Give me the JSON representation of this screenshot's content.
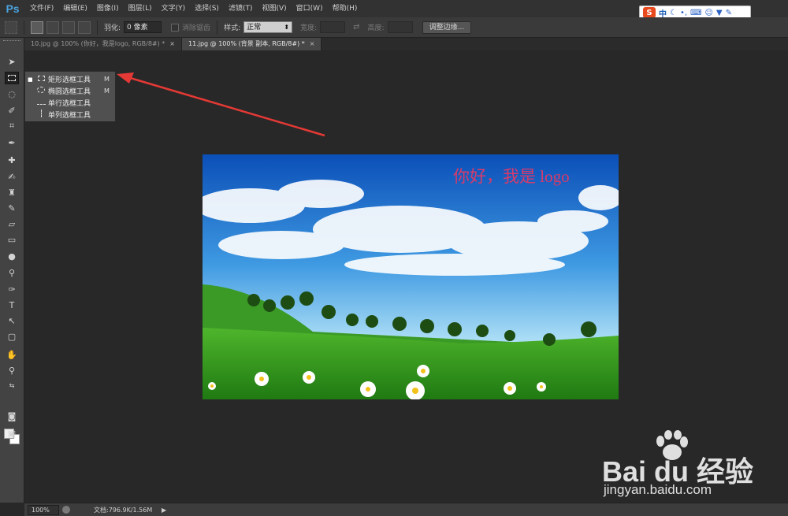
{
  "app": {
    "logo_text": "Ps",
    "menus": [
      "文件(F)",
      "编辑(E)",
      "图像(I)",
      "图层(L)",
      "文字(Y)",
      "选择(S)",
      "滤镜(T)",
      "视图(V)",
      "窗口(W)",
      "帮助(H)"
    ]
  },
  "ime": {
    "logo": "S",
    "mode": "中",
    "icons": [
      "moon-icon",
      "punctuation-icon",
      "keyboard-icon",
      "user-icon",
      "shirt-icon",
      "wrench-icon"
    ]
  },
  "options": {
    "feather_label": "羽化:",
    "feather_value": "0 像素",
    "antialias_label": "消除锯齿",
    "style_label": "样式:",
    "style_value": "正常",
    "width_label": "宽度:",
    "height_label": "高度:",
    "refine_edge_button": "调整边缘..."
  },
  "tabs": [
    {
      "label": "10.jpg @ 100% (你好，我是logo, RGB/8#) *",
      "active": false
    },
    {
      "label": "11.jpg @ 100% (背景 副本, RGB/8#) *",
      "active": true
    }
  ],
  "tab_close": "×",
  "flyout": {
    "items": [
      {
        "label": "矩形选框工具",
        "key": "M",
        "selected": true
      },
      {
        "label": "椭圆选框工具",
        "key": "M",
        "selected": false
      },
      {
        "label": "单行选框工具",
        "key": "",
        "selected": false
      },
      {
        "label": "单列选框工具",
        "key": "",
        "selected": false
      }
    ]
  },
  "document": {
    "overlay_text": "你好，我是 logo"
  },
  "status": {
    "zoom": "100%",
    "doc_info": "文档:796.9K/1.56M",
    "arrow": "▶"
  },
  "watermark": {
    "main": "Bai du 经验",
    "url": "jingyan.baidu.com"
  },
  "colors": {
    "accent": "#4aa3df",
    "overlay_text": "#d93b6a",
    "arrow": "#e53935"
  }
}
